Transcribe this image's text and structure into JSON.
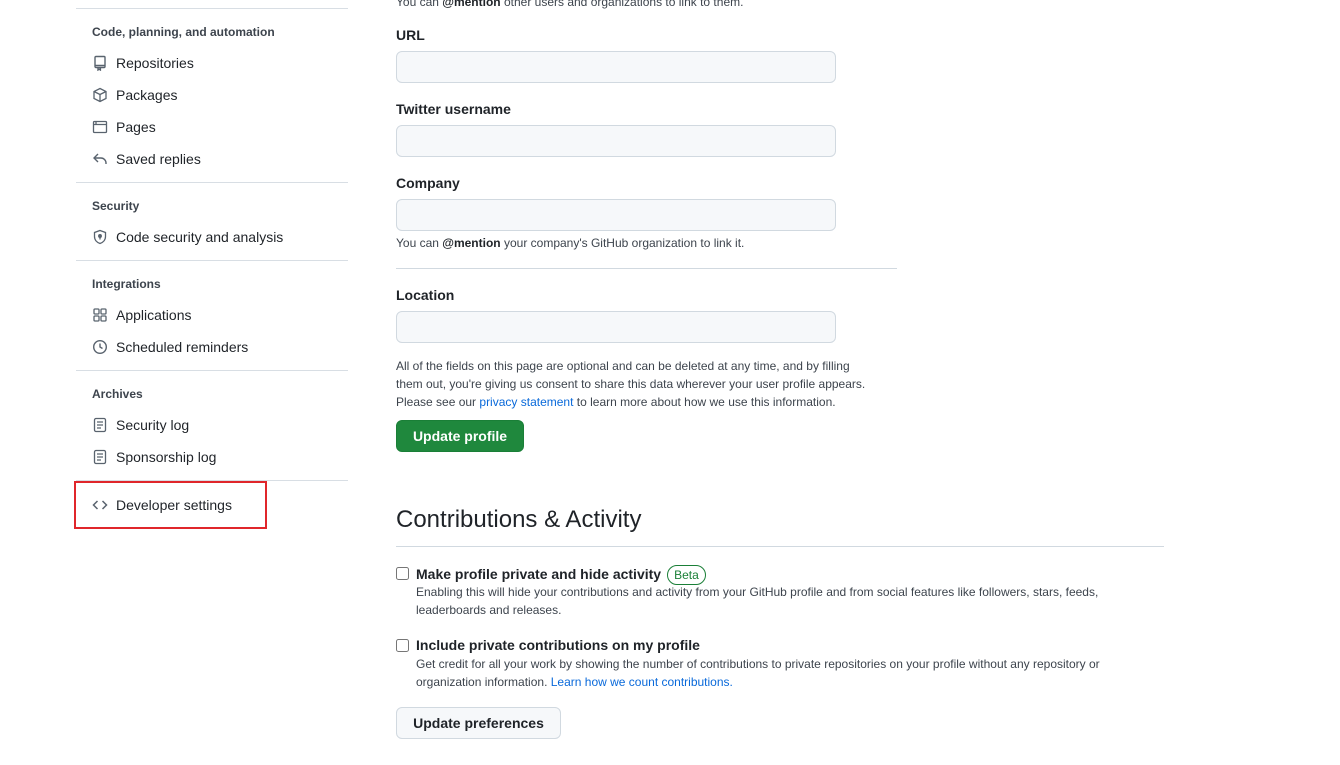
{
  "sidebar": {
    "groups": [
      {
        "title": "Code, planning, and automation",
        "items": [
          {
            "label": "Repositories",
            "icon": "repo-icon"
          },
          {
            "label": "Packages",
            "icon": "package-icon"
          },
          {
            "label": "Pages",
            "icon": "browser-icon"
          },
          {
            "label": "Saved replies",
            "icon": "reply-icon"
          }
        ]
      },
      {
        "title": "Security",
        "items": [
          {
            "label": "Code security and analysis",
            "icon": "shield-lock-icon"
          }
        ]
      },
      {
        "title": "Integrations",
        "items": [
          {
            "label": "Applications",
            "icon": "apps-icon"
          },
          {
            "label": "Scheduled reminders",
            "icon": "clock-icon"
          }
        ]
      },
      {
        "title": "Archives",
        "items": [
          {
            "label": "Security log",
            "icon": "log-icon"
          },
          {
            "label": "Sponsorship log",
            "icon": "log-icon"
          }
        ]
      }
    ],
    "developer_settings": {
      "label": "Developer settings",
      "icon": "code-icon"
    }
  },
  "profile_form": {
    "top_note_prefix": "You can ",
    "top_note_mention": "@mention",
    "top_note_suffix": " other users and organizations to link to them.",
    "url": {
      "label": "URL",
      "value": ""
    },
    "twitter": {
      "label": "Twitter username",
      "value": ""
    },
    "company": {
      "label": "Company",
      "value": ""
    },
    "company_note_prefix": "You can ",
    "company_note_mention": "@mention",
    "company_note_suffix": " your company's GitHub organization to link it.",
    "location": {
      "label": "Location",
      "value": ""
    },
    "disclaimer_line1": "All of the fields on this page are optional and can be deleted at any time, and by filling",
    "disclaimer_line2": "them out, you're giving us consent to share this data wherever your user profile appears.",
    "disclaimer_line3_prefix": "Please see our ",
    "disclaimer_link": "privacy statement",
    "disclaimer_line3_suffix": " to learn more about how we use this information.",
    "submit_label": "Update profile"
  },
  "contributions": {
    "heading": "Contributions & Activity",
    "private_profile": {
      "label": "Make profile private and hide activity",
      "badge": "Beta",
      "checked": false,
      "desc_line1": "Enabling this will hide your contributions and activity from your GitHub profile and from social features like followers, stars, feeds,",
      "desc_line2": "leaderboards and releases."
    },
    "private_contributions": {
      "label": "Include private contributions on my profile",
      "checked": false,
      "desc_line1": "Get credit for all your work by showing the number of contributions to private repositories on your profile without any repository or",
      "desc_line2_prefix": "organization information. ",
      "desc_link": "Learn how we count contributions."
    },
    "submit_label": "Update preferences"
  }
}
